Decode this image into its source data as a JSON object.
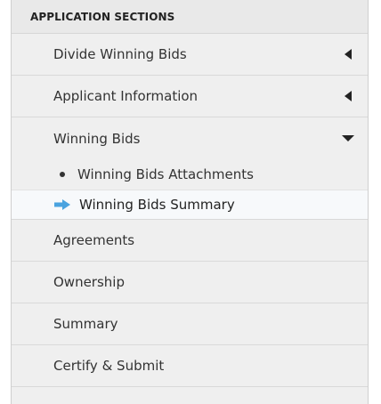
{
  "nav": {
    "header": "APPLICATION SECTIONS",
    "items": [
      {
        "label": "Divide Winning Bids",
        "state": "collapsed"
      },
      {
        "label": "Applicant Information",
        "state": "collapsed"
      },
      {
        "label": "Winning Bids",
        "state": "expanded",
        "children": [
          {
            "label": "Winning Bids Attachments",
            "active": false
          },
          {
            "label": "Winning Bids Summary",
            "active": true
          }
        ]
      },
      {
        "label": "Agreements"
      },
      {
        "label": "Ownership"
      },
      {
        "label": "Summary"
      },
      {
        "label": "Certify & Submit"
      }
    ]
  },
  "colors": {
    "accent_arrow": "#4aa3df",
    "panel_bg": "#efefef"
  },
  "icons": {
    "collapsed": "caret-left-icon",
    "expanded": "caret-down-icon",
    "active": "arrow-right-icon",
    "bullet": "bullet-icon"
  }
}
